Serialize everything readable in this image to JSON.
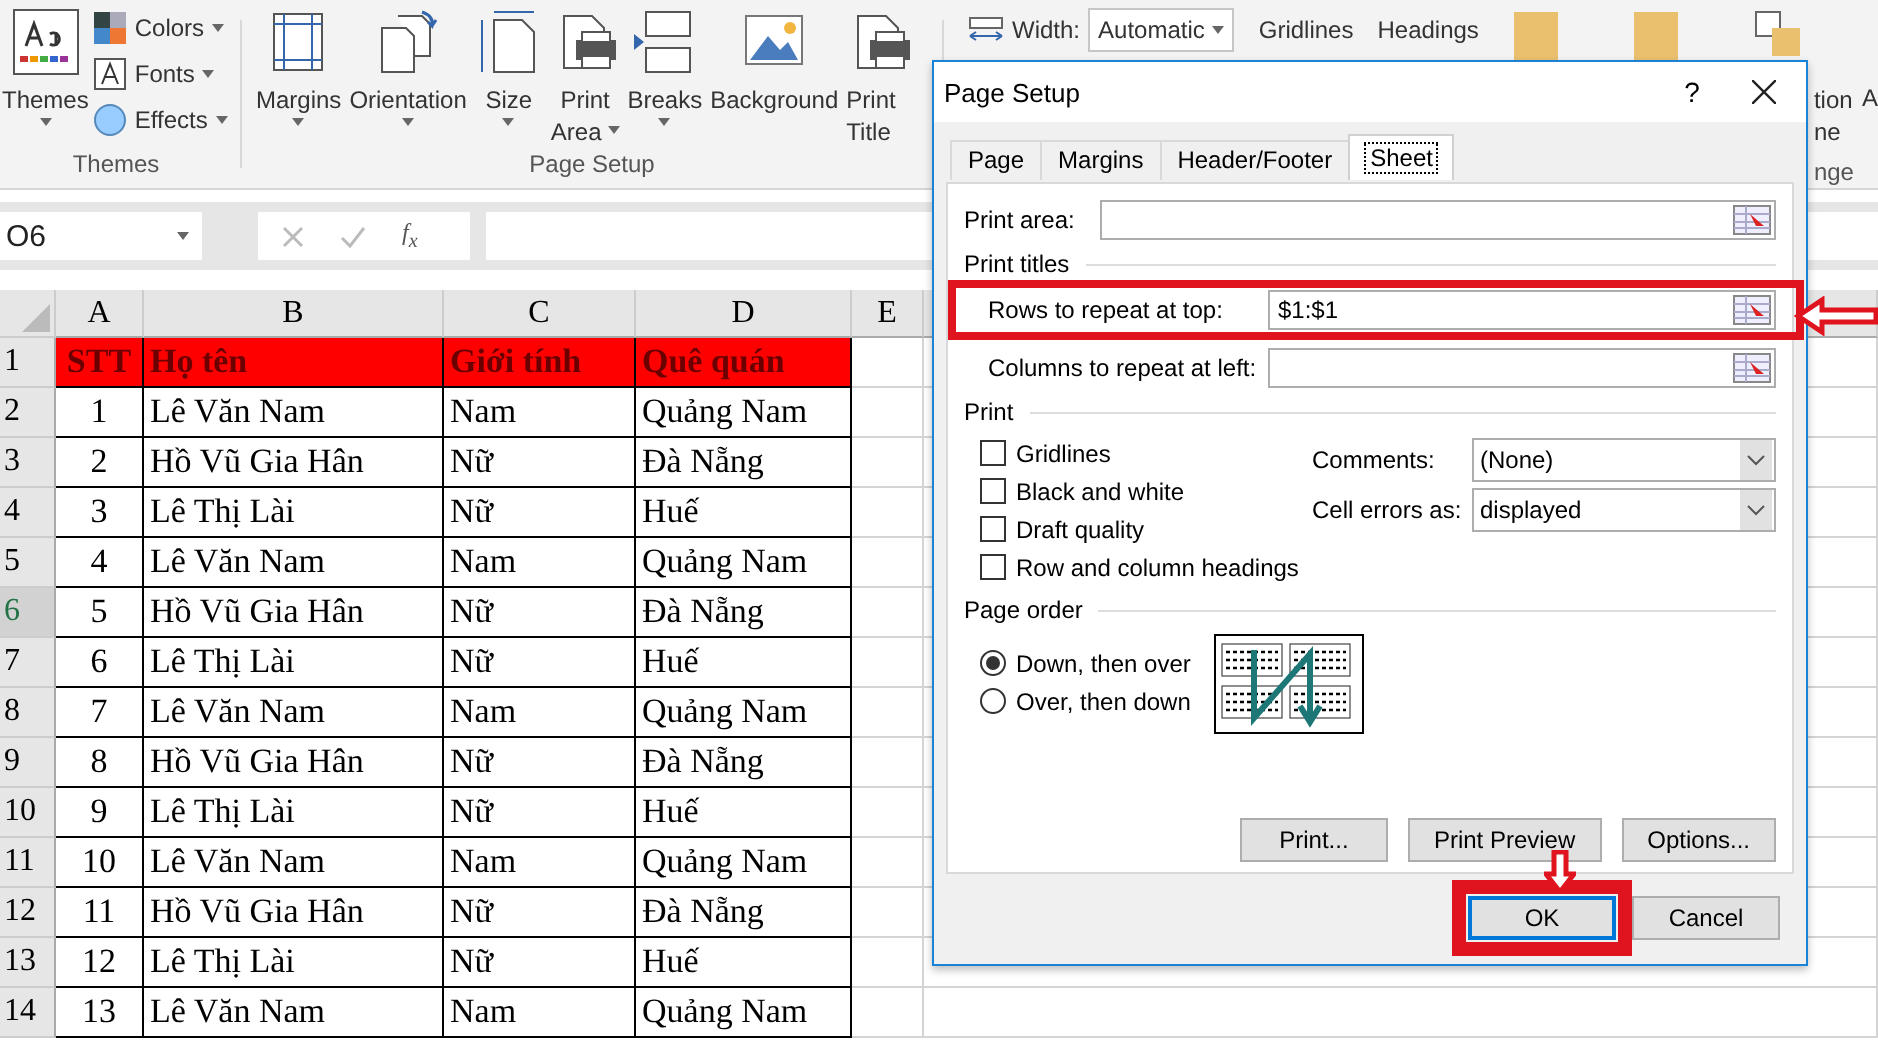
{
  "ribbon": {
    "themes_group": {
      "label": "Themes",
      "big_button": {
        "lines": [
          "Themes"
        ],
        "dropdown": true
      },
      "small_buttons": [
        {
          "kind": "colors",
          "label": "Colors"
        },
        {
          "kind": "fonts",
          "label": "Fonts"
        },
        {
          "kind": "effects",
          "label": "Effects"
        }
      ]
    },
    "page_setup_group": {
      "label": "Page Setup",
      "buttons": [
        {
          "kind": "margins",
          "lines": [
            "Margins"
          ],
          "dropdown": true
        },
        {
          "kind": "orientation",
          "lines": [
            "Orientation"
          ],
          "dropdown": true
        },
        {
          "kind": "size",
          "lines": [
            "Size"
          ],
          "dropdown": true
        },
        {
          "kind": "print_area",
          "lines": [
            "Print",
            "Area"
          ],
          "dropdown": true
        },
        {
          "kind": "breaks",
          "lines": [
            "Breaks"
          ],
          "dropdown": true
        },
        {
          "kind": "background",
          "lines": [
            "Background"
          ],
          "dropdown": false
        },
        {
          "kind": "print_titles",
          "lines": [
            "Print",
            "Title"
          ],
          "dropdown": false
        }
      ]
    },
    "scale": {
      "width_label": "Width:",
      "width_value": "Automatic"
    },
    "sheet_options": [
      "Gridlines",
      "Headings"
    ],
    "arrange_fragments": {
      "lines": [
        "tion",
        "ne"
      ],
      "group_label": "nge",
      "next_label": "A"
    }
  },
  "formula_bar": {
    "name_box": "O6",
    "function_label": "f$_{x}$"
  },
  "sheet": {
    "columns": [
      "A",
      "B",
      "C",
      "D",
      "E"
    ],
    "header_row": {
      "number": "1",
      "cells": [
        "STT",
        "Họ tên",
        "Giới tính",
        "Quê quán"
      ]
    },
    "rows": [
      {
        "number": "2",
        "selected": false,
        "cells": [
          "1",
          "Lê Văn Nam",
          "Nam",
          "Quảng Nam"
        ]
      },
      {
        "number": "3",
        "selected": false,
        "cells": [
          "2",
          "Hồ Vũ Gia Hân",
          "Nữ",
          "Đà Nẵng"
        ]
      },
      {
        "number": "4",
        "selected": false,
        "cells": [
          "3",
          "Lê Thị Lài",
          "Nữ",
          "Huế"
        ]
      },
      {
        "number": "5",
        "selected": false,
        "cells": [
          "4",
          "Lê Văn Nam",
          "Nam",
          "Quảng Nam"
        ]
      },
      {
        "number": "6",
        "selected": true,
        "cells": [
          "5",
          "Hồ Vũ Gia Hân",
          "Nữ",
          "Đà Nẵng"
        ]
      },
      {
        "number": "7",
        "selected": false,
        "cells": [
          "6",
          "Lê Thị Lài",
          "Nữ",
          "Huế"
        ]
      },
      {
        "number": "8",
        "selected": false,
        "cells": [
          "7",
          "Lê Văn Nam",
          "Nam",
          "Quảng Nam"
        ]
      },
      {
        "number": "9",
        "selected": false,
        "cells": [
          "8",
          "Hồ Vũ Gia Hân",
          "Nữ",
          "Đà Nẵng"
        ]
      },
      {
        "number": "10",
        "selected": false,
        "cells": [
          "9",
          "Lê Thị Lài",
          "Nữ",
          "Huế"
        ]
      },
      {
        "number": "11",
        "selected": false,
        "cells": [
          "10",
          "Lê Văn Nam",
          "Nam",
          "Quảng Nam"
        ]
      },
      {
        "number": "12",
        "selected": false,
        "cells": [
          "11",
          "Hồ Vũ Gia Hân",
          "Nữ",
          "Đà Nẵng"
        ]
      },
      {
        "number": "13",
        "selected": false,
        "cells": [
          "12",
          "Lê Thị Lài",
          "Nữ",
          "Huế"
        ]
      },
      {
        "number": "14",
        "selected": false,
        "cells": [
          "13",
          "Lê Văn Nam",
          "Nam",
          "Quảng Nam"
        ]
      }
    ]
  },
  "dialog": {
    "title": "Page Setup",
    "help": "?",
    "tabs": [
      {
        "label": "Page",
        "selected": false
      },
      {
        "label": "Margins",
        "selected": false
      },
      {
        "label": "Header/Footer",
        "selected": false
      },
      {
        "label": "Sheet",
        "selected": true
      }
    ],
    "print_area": {
      "label": "Print area:"
    },
    "print_titles": {
      "label": "Print titles",
      "fields": [
        {
          "label": "Rows to repeat at top:",
          "value": "$1:$1",
          "highlighted": true
        },
        {
          "label": "Columns to repeat at left:",
          "highlighted": false
        }
      ]
    },
    "print": {
      "label": "Print",
      "checkboxes": [
        {
          "label": "Gridlines",
          "checked": false
        },
        {
          "label": "Black and white",
          "checked": false
        },
        {
          "label": "Draft quality",
          "checked": false
        },
        {
          "label": "Row and column headings",
          "checked": false
        }
      ],
      "dropdowns": [
        {
          "label": "Comments:",
          "value": "(None)"
        },
        {
          "label": "Cell errors as:",
          "value": "displayed"
        }
      ]
    },
    "page_order": {
      "label": "Page order",
      "options": [
        {
          "label": "Down, then over",
          "selected": true
        },
        {
          "label": "Over, then down",
          "selected": false
        }
      ]
    },
    "panel_buttons": [
      "Print...",
      "Print Preview",
      "Options..."
    ],
    "footer_buttons": [
      {
        "label": "OK",
        "highlighted": true
      },
      {
        "label": "Cancel",
        "highlighted": false
      }
    ]
  }
}
